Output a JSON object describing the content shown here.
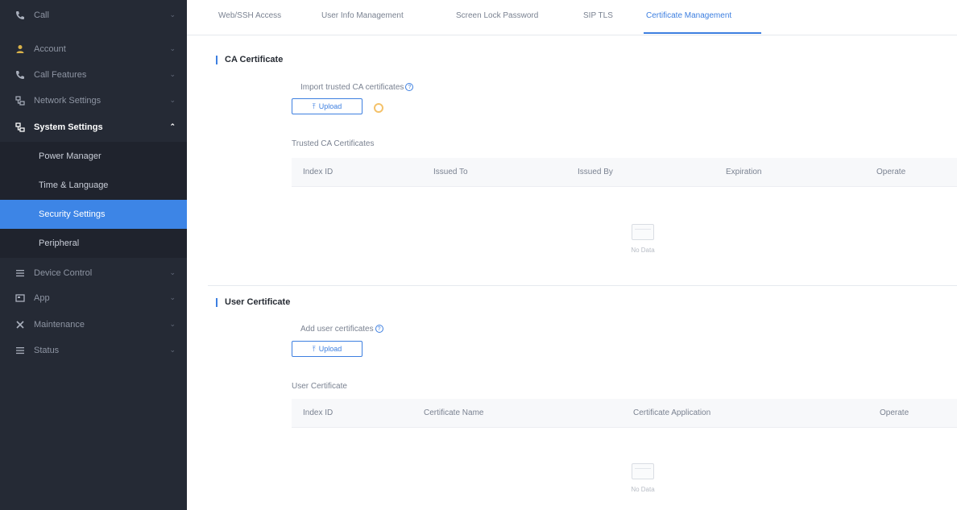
{
  "sidebar": {
    "items": [
      {
        "label": "Call",
        "icon": "phone-icon"
      },
      {
        "label": "Account",
        "icon": "user-icon"
      },
      {
        "label": "Call Features",
        "icon": "call-features-icon"
      },
      {
        "label": "Network Settings",
        "icon": "network-icon"
      },
      {
        "label": "System Settings",
        "icon": "system-settings-icon",
        "expanded": true
      },
      {
        "label": "Device Control",
        "icon": "list-icon"
      },
      {
        "label": "App",
        "icon": "app-icon"
      },
      {
        "label": "Maintenance",
        "icon": "tools-icon"
      },
      {
        "label": "Status",
        "icon": "list-icon"
      }
    ],
    "sub_items": [
      {
        "label": "Power Manager"
      },
      {
        "label": "Time & Language"
      },
      {
        "label": "Security Settings",
        "active": true
      },
      {
        "label": "Peripheral"
      }
    ]
  },
  "tabs": [
    {
      "label": "Web/SSH Access"
    },
    {
      "label": "User Info Management"
    },
    {
      "label": "Screen Lock Password"
    },
    {
      "label": "SIP TLS"
    },
    {
      "label": "Certificate Management",
      "active": true
    }
  ],
  "ca_section": {
    "title": "CA Certificate",
    "import_label": "Import trusted CA certificates",
    "upload_label": "Upload",
    "table_title": "Trusted CA Certificates",
    "columns": [
      "Index ID",
      "Issued To",
      "Issued By",
      "Expiration",
      "Operate"
    ],
    "empty_text": "No Data"
  },
  "user_section": {
    "title": "User Certificate",
    "add_label": "Add user certificates",
    "upload_label": "Upload",
    "table_title": "User Certificate",
    "columns": [
      "Index ID",
      "Certificate Name",
      "Certificate Application",
      "Operate"
    ],
    "empty_text": "No Data"
  },
  "colors": {
    "sidebar_bg": "#252a35",
    "accent": "#3d7fe0",
    "active_item": "#3d85e6"
  }
}
